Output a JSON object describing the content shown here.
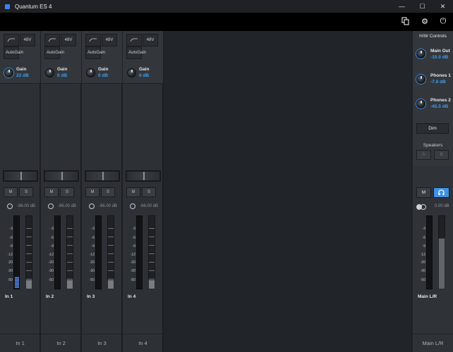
{
  "window": {
    "title": "Quantum ES 4",
    "controls": [
      "minimize",
      "maximize",
      "close"
    ]
  },
  "toolbar": {
    "icons": [
      "copy-icon",
      "gear-icon",
      "power-icon"
    ]
  },
  "scale_labels": [
    "-3",
    "-6",
    "-9",
    "-12",
    "-20",
    "-30",
    "-50"
  ],
  "channels": [
    {
      "hp_label": "",
      "v48_label": "48V",
      "auto_label_1": "Auto",
      "auto_label_2": "Gain",
      "gain_label": "Gain",
      "gain_value": "22 dB",
      "mute": "M",
      "solo": "S",
      "peak": "-96.00 dB",
      "name": "In 1",
      "footer": "In 1",
      "meter_level": 0.16
    },
    {
      "hp_label": "",
      "v48_label": "48V",
      "auto_label_1": "Auto",
      "auto_label_2": "Gain",
      "gain_label": "Gain",
      "gain_value": "0 dB",
      "mute": "M",
      "solo": "S",
      "peak": "-96.00 dB",
      "name": "In 2",
      "footer": "In 2",
      "meter_level": 0
    },
    {
      "hp_label": "",
      "v48_label": "48V",
      "auto_label_1": "Auto",
      "auto_label_2": "Gain",
      "gain_label": "Gain",
      "gain_value": "0 dB",
      "mute": "M",
      "solo": "S",
      "peak": "-96.00 dB",
      "name": "In 3",
      "footer": "In 3",
      "meter_level": 0
    },
    {
      "hp_label": "",
      "v48_label": "48V",
      "auto_label_1": "Auto",
      "auto_label_2": "Gain",
      "gain_label": "Gain",
      "gain_value": "0 dB",
      "mute": "M",
      "solo": "S",
      "peak": "-96.00 dB",
      "name": "In 4",
      "footer": "In 4",
      "meter_level": 0
    }
  ],
  "hw": {
    "title": "H/W Controls",
    "main_out_label": "Main Out",
    "main_out_value": "-10.0 dB",
    "phones1_label": "Phones 1",
    "phones1_value": "-7.8 dB",
    "phones2_label": "Phones 2",
    "phones2_value": "-45.5 dB",
    "dim": "Dim",
    "speakers_label": "Speakers",
    "spk_a": "A",
    "spk_b": "B",
    "mute": "M",
    "peak": "0.00 dB",
    "name": "Main L/R",
    "footer": "Main L/R",
    "accent_color": "#3e91e6"
  }
}
